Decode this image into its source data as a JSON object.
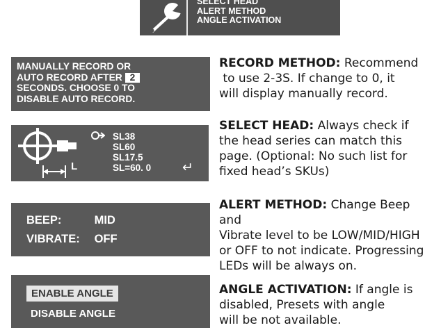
{
  "menu": {
    "items": [
      "SELECT HEAD",
      "ALERT METHOD",
      "ANGLE ACTIVATION"
    ],
    "icon": "wrench-icon"
  },
  "record_panel": {
    "line1": "MANUALLY RECORD OR",
    "line2_prefix": "AUTO RECORD AFTER",
    "value": "2",
    "line3": "SECONDS. CHOOSE 0 TO",
    "line4": "DISABLE AUTO RECORD."
  },
  "head_panel": {
    "dimension_label": "L",
    "heads": [
      "SL38",
      "SL60",
      "SL17.5",
      "SL=60. 0"
    ],
    "enter_symbol": "↵"
  },
  "alert_panel": {
    "beep_label": "BEEP:",
    "beep_value": "MID",
    "vibrate_label": "VIBRATE:",
    "vibrate_value": "OFF"
  },
  "angle_panel": {
    "enable_label": "ENABLE ANGLE",
    "disable_label": "DISABLE ANGLE"
  },
  "captions": {
    "record": {
      "heading": "RECORD METHOD:",
      "lines": [
        "Recommend",
        " to use 2-3S. If change to 0, it",
        "will display manually record."
      ]
    },
    "head": {
      "heading": "SELECT HEAD:",
      "lines": [
        "Always check if",
        "the head series can match this",
        "page. (Optional: No such list for",
        "fixed head’s SKUs)"
      ]
    },
    "alert": {
      "heading": "ALERT METHOD:",
      "lines": [
        "Change Beep and",
        "Vibrate level to be LOW/MID/HIGH",
        "or OFF to not indicate. Progressing",
        "LEDs will be always on."
      ]
    },
    "angle": {
      "heading": "ANGLE ACTIVATION:",
      "lines": [
        "If angle is",
        "disabled, Presets with angle",
        "will be not available."
      ]
    }
  },
  "colors": {
    "panel": "#595959",
    "menu_panel": "#4f4f4f",
    "text_light": "#ffffff",
    "caption_text": "#1a1a1a"
  }
}
